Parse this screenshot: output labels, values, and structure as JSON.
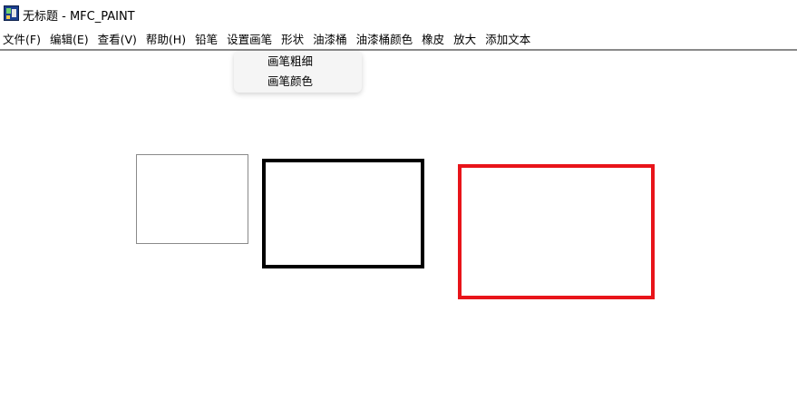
{
  "window": {
    "title": "无标题 - MFC_PAINT",
    "icon": "mfc-paint-app-icon"
  },
  "menubar": {
    "items": [
      {
        "label": "文件(F)"
      },
      {
        "label": "编辑(E)"
      },
      {
        "label": "查看(V)"
      },
      {
        "label": "帮助(H)"
      },
      {
        "label": "铅笔"
      },
      {
        "label": "设置画笔"
      },
      {
        "label": "形状"
      },
      {
        "label": "油漆桶"
      },
      {
        "label": "油漆桶颜色"
      },
      {
        "label": "橡皮"
      },
      {
        "label": "放大"
      },
      {
        "label": "添加文本"
      }
    ],
    "open_menu": "设置画笔"
  },
  "dropdown": {
    "items": [
      {
        "label": "画笔粗细"
      },
      {
        "label": "画笔颜色"
      }
    ]
  },
  "canvas": {
    "shapes": [
      {
        "type": "rectangle",
        "stroke": "#8a8a8a"
      },
      {
        "type": "rectangle",
        "stroke": "#000000"
      },
      {
        "type": "rectangle",
        "stroke": "#e8141a"
      }
    ]
  }
}
